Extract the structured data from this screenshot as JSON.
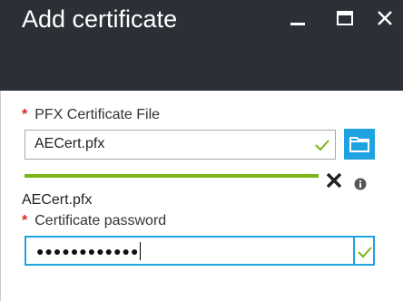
{
  "window": {
    "title": "Add certificate",
    "controls": [
      "minimize-icon",
      "maximize-icon",
      "close-icon"
    ]
  },
  "form": {
    "pfx_file": {
      "required_marker": "*",
      "label": "PFX Certificate File",
      "value": "AECert.pfx",
      "valid_icon": "check-icon",
      "browse_icon": "folder-icon"
    },
    "upload": {
      "progress": 1.0,
      "cancel_icon": "x-icon",
      "info_icon": "info-icon",
      "file_name": "AECert.pfx"
    },
    "password": {
      "required_marker": "*",
      "label": "Certificate password",
      "masked_value": "●●●●●●●●●●●●",
      "valid_icon": "check-icon"
    }
  },
  "colors": {
    "title_bar": "#2b3037",
    "accent": "#1ea3e0",
    "success": "#7bb614",
    "required": "#d6281d"
  }
}
